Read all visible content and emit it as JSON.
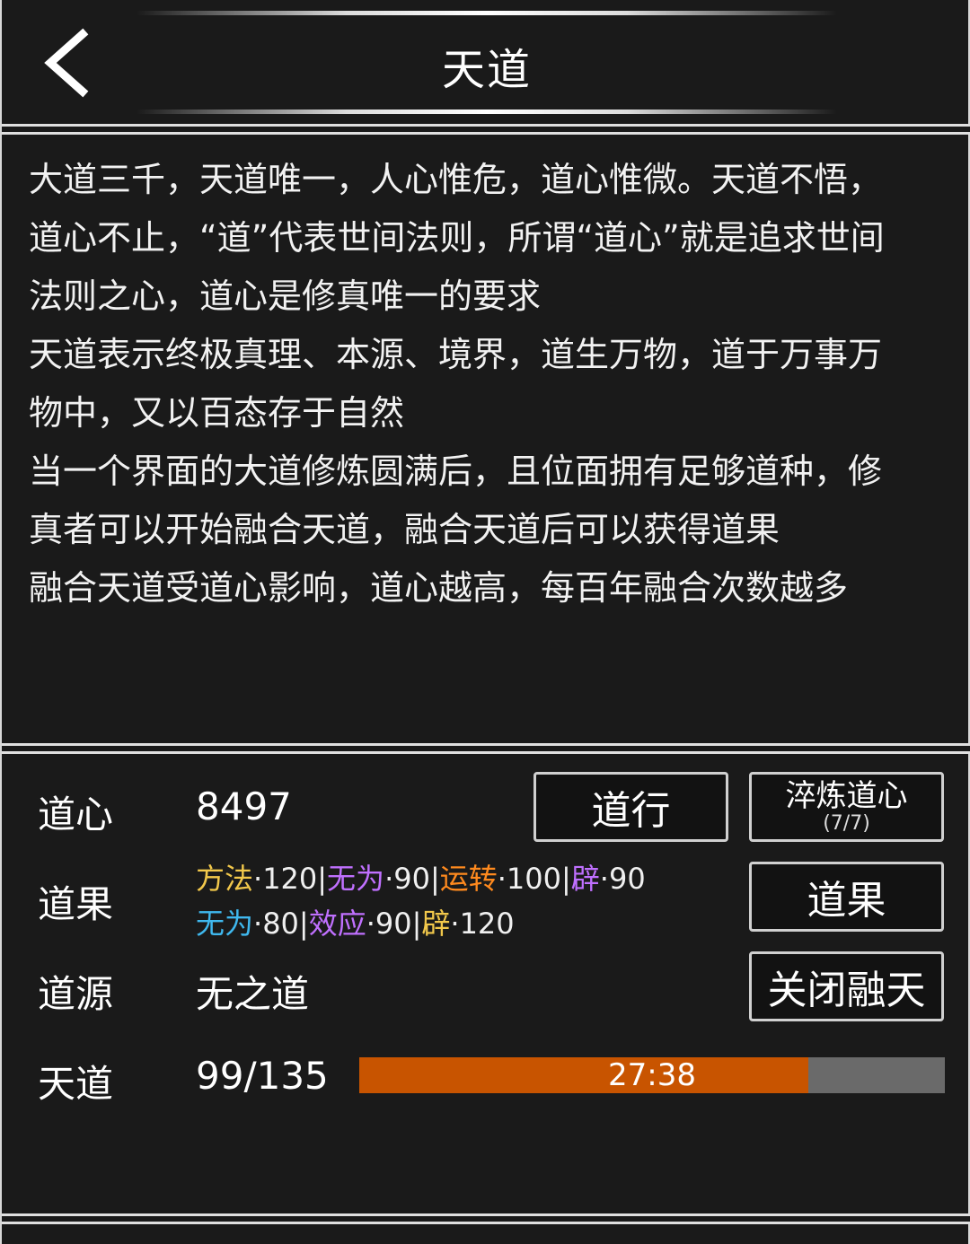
{
  "header": {
    "title": "天道",
    "back_icon": "chevron-left-icon"
  },
  "description": {
    "lines": [
      "大道三千，天道唯一，人心惟危，道心惟微。天道不悟，",
      "道心不止，“道”代表世间法则，所谓“道心”就是追求世间",
      "法则之心，道心是修真唯一的要求",
      "天道表示终极真理、本源、境界，道生万物，道于万事万",
      "物中，又以百态存于自然",
      "当一个界面的大道修炼圆满后，且位面拥有足够道种，修",
      "真者可以开始融合天道，融合天道后可以获得道果",
      "融合天道受道心影响，道心越高，每百年融合次数越多"
    ]
  },
  "stats": {
    "daoxin": {
      "label": "道心",
      "value": "8497"
    },
    "daoguo": {
      "label": "道果",
      "line1": [
        {
          "name": "方法",
          "sep": "·",
          "num": "120",
          "color": "#f2c84b"
        },
        {
          "name": "无为",
          "sep": "·",
          "num": "90",
          "color": "#c070ff"
        },
        {
          "name": "运转",
          "sep": "·",
          "num": "100",
          "color": "#ff8a1e"
        },
        {
          "name": "辟",
          "sep": "·",
          "num": "90",
          "color": "#c070ff"
        }
      ],
      "line2": [
        {
          "name": "无为",
          "sep": "·",
          "num": "80",
          "color": "#3fb8ee"
        },
        {
          "name": "效应",
          "sep": "·",
          "num": "90",
          "color": "#c070ff"
        },
        {
          "name": "辟",
          "sep": "·",
          "num": "120",
          "color": "#f2c84b"
        }
      ]
    },
    "daoyuan": {
      "label": "道源",
      "value": "无之道"
    },
    "tiandao": {
      "label": "天道",
      "value": "99/135",
      "timer": "27:38",
      "progress": 0.767
    }
  },
  "buttons": {
    "daoxing": "道行",
    "cuilian_main": "淬炼道心",
    "cuilian_sub": "(7/7)",
    "daoguo": "道果",
    "close_rongtian": "关闭融天"
  },
  "colors": {
    "background": "#1a1a1a",
    "progress_fill": "#c85400",
    "progress_track": "#6a6a6a"
  }
}
